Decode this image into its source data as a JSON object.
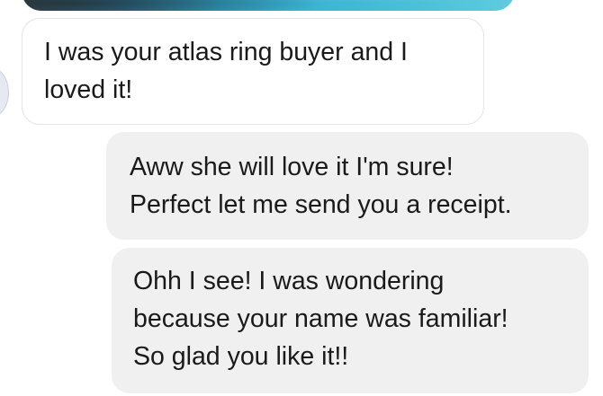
{
  "conversation": {
    "messages": [
      {
        "direction": "incoming",
        "text": "I was your atlas ring buyer and I\nloved it!"
      },
      {
        "direction": "outgoing",
        "text": "Aww she will love it I'm sure!\nPerfect let me send you a receipt."
      },
      {
        "direction": "outgoing",
        "text": "Ohh I see! I was wondering\nbecause your name was familiar!\nSo glad you like it!!"
      }
    ]
  },
  "colors": {
    "incoming_bubble": "#ffffff",
    "incoming_border": "#e3e4e8",
    "outgoing_bubble": "#f0f0f0",
    "text": "#1a1a1a"
  },
  "icons": {
    "attachment": "photo-icon",
    "sender": "avatar-icon"
  }
}
